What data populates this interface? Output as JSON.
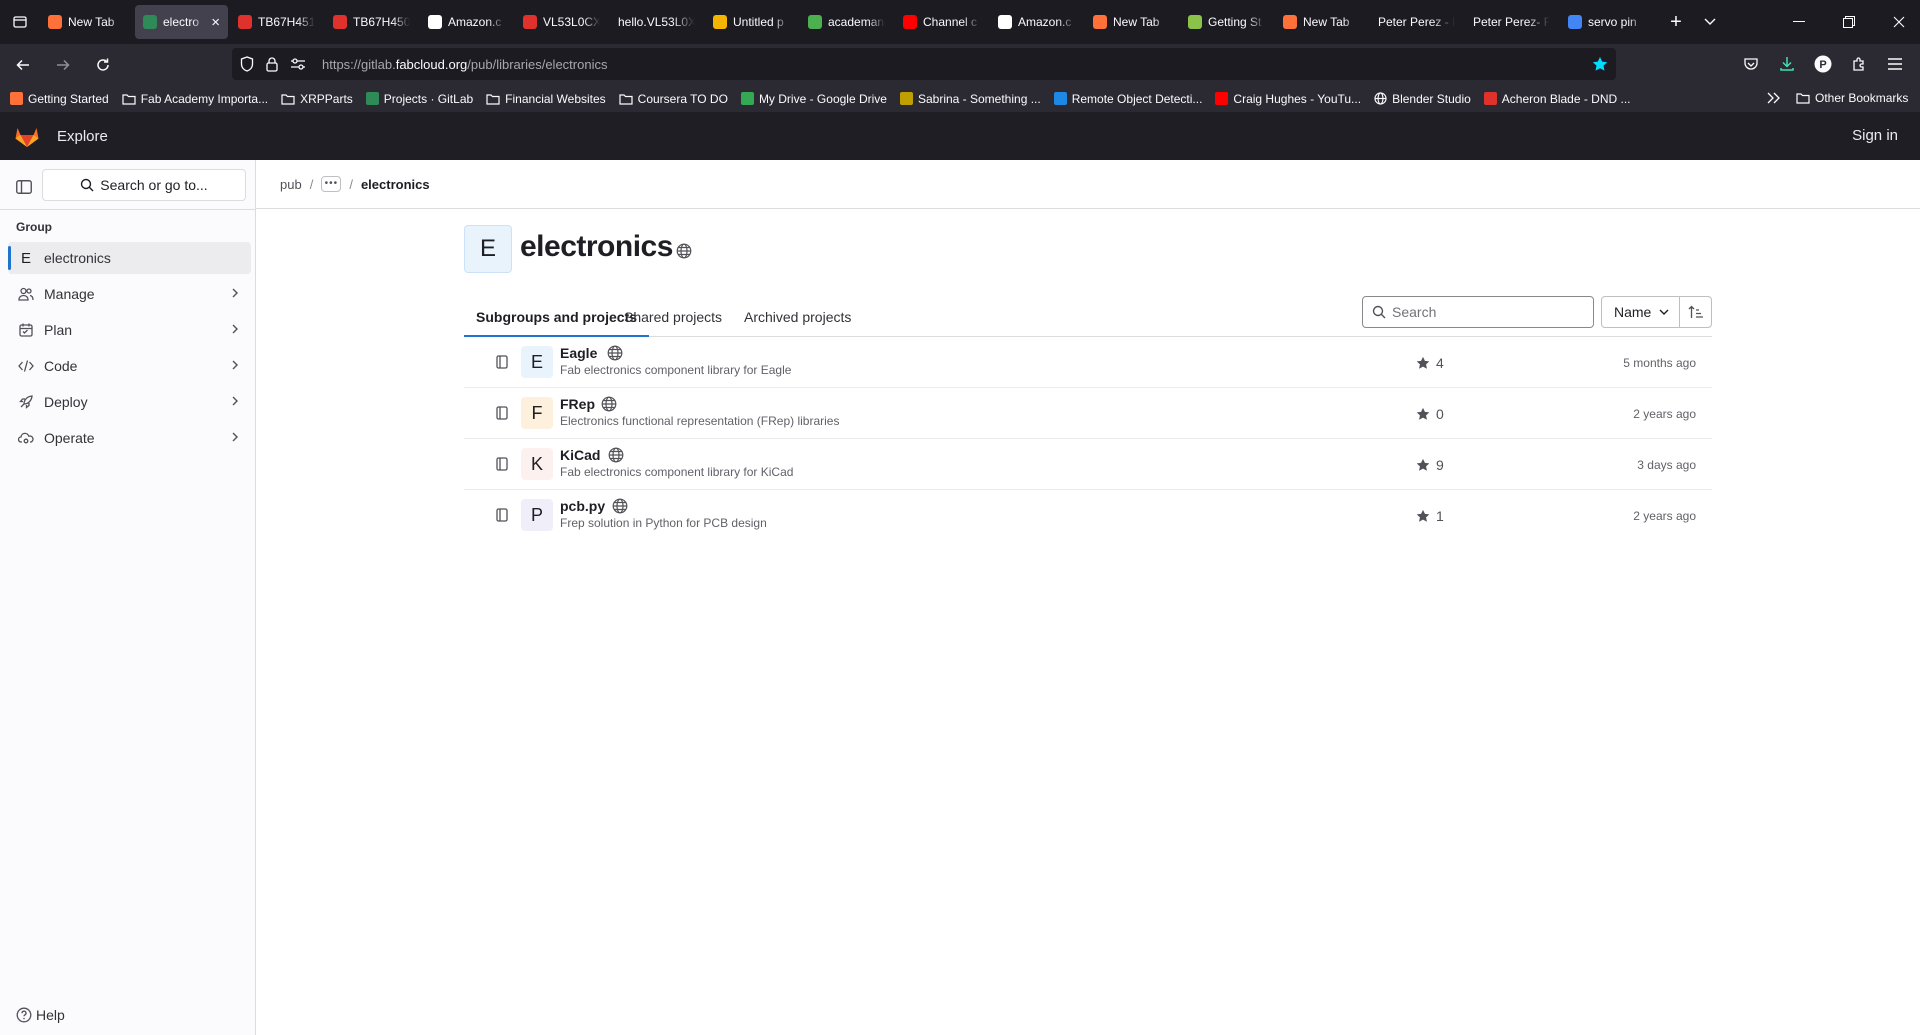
{
  "browser": {
    "tabs": [
      {
        "title": "New Tab",
        "favicon_color": "#ff7139",
        "active": false
      },
      {
        "title": "electro",
        "favicon_color": "#2e8b57",
        "active": true
      },
      {
        "title": "TB67H451",
        "favicon_color": "#e0322d",
        "active": false
      },
      {
        "title": "TB67H450",
        "favicon_color": "#e0322d",
        "active": false
      },
      {
        "title": "Amazon.c",
        "favicon_color": "#ffffff",
        "active": false
      },
      {
        "title": "VL53L0CX",
        "favicon_color": "#e0322d",
        "active": false
      },
      {
        "title": "hello.VL53L0X",
        "favicon_color": "",
        "active": false
      },
      {
        "title": "Untitled p",
        "favicon_color": "#f4b400",
        "active": false
      },
      {
        "title": "academan",
        "favicon_color": "#4caf50",
        "active": false
      },
      {
        "title": "Channel c",
        "favicon_color": "#ff0000",
        "active": false
      },
      {
        "title": "Amazon.c",
        "favicon_color": "#ffffff",
        "active": false
      },
      {
        "title": "New Tab",
        "favicon_color": "#ff7139",
        "active": false
      },
      {
        "title": "Getting St",
        "favicon_color": "#8bc34a",
        "active": false
      },
      {
        "title": "New Tab",
        "favicon_color": "#ff7139",
        "active": false
      },
      {
        "title": "Peter Perez - F",
        "favicon_color": "",
        "active": false
      },
      {
        "title": "Peter Perez- F",
        "favicon_color": "",
        "active": false
      },
      {
        "title": "servo pin",
        "favicon_color": "#4285f4",
        "active": false
      }
    ],
    "tab_close": "×",
    "new_tab": "+",
    "url_prefix": "https://gitlab.",
    "url_domain": "fabcloud.org",
    "url_path": "/pub/libraries/electronics",
    "bookmarks": [
      {
        "label": "Getting Started",
        "icon": "firefox-icon",
        "color": "#ff7139"
      },
      {
        "label": "Fab Academy Importa...",
        "icon": "folder-icon",
        "color": ""
      },
      {
        "label": "XRPParts",
        "icon": "folder-icon",
        "color": ""
      },
      {
        "label": "Projects · GitLab",
        "icon": "gitlab-icon",
        "color": "#2e8b57"
      },
      {
        "label": "Financial Websites",
        "icon": "folder-icon",
        "color": ""
      },
      {
        "label": "Coursera TO DO",
        "icon": "folder-icon",
        "color": ""
      },
      {
        "label": "My Drive - Google Drive",
        "icon": "drive-icon",
        "color": "#34a853"
      },
      {
        "label": "Sabrina - Something ...",
        "icon": "music-icon",
        "color": "#c0a000"
      },
      {
        "label": "Remote Object Detecti...",
        "icon": "hackster-icon",
        "color": "#1e88e5"
      },
      {
        "label": "Craig Hughes - YouTu...",
        "icon": "youtube-icon",
        "color": "#ff0000"
      },
      {
        "label": "Blender Studio",
        "icon": "globe-icon",
        "color": ""
      },
      {
        "label": "Acheron Blade - DND ...",
        "icon": "dnd-icon",
        "color": "#e0322d"
      }
    ],
    "other_bookmarks": "Other Bookmarks"
  },
  "gitlab": {
    "explore": "Explore",
    "sign_in": "Sign in",
    "search_placeholder": "Search or go to...",
    "sidebar": {
      "group_heading": "Group",
      "items": [
        {
          "label": "electronics",
          "icon_letter": "E"
        },
        {
          "label": "Manage"
        },
        {
          "label": "Plan"
        },
        {
          "label": "Code"
        },
        {
          "label": "Deploy"
        },
        {
          "label": "Operate"
        }
      ],
      "help": "Help"
    },
    "breadcrumb": {
      "root": "pub",
      "more": "•••",
      "current": "electronics",
      "separator": "/"
    },
    "group": {
      "avatar_letter": "E",
      "title": "electronics"
    },
    "tabs": [
      "Subgroups and projects",
      "Shared projects",
      "Archived projects"
    ],
    "filter_placeholder": "Search",
    "sort_label": "Name",
    "projects": [
      {
        "letter": "E",
        "name": "Eagle",
        "description": "Fab electronics component library for Eagle",
        "stars": "4",
        "updated": "5 months ago",
        "avatar_bg": "#e9f3fc"
      },
      {
        "letter": "F",
        "name": "FRep",
        "description": "Electronics functional representation (FRep) libraries",
        "stars": "0",
        "updated": "2 years ago",
        "avatar_bg": "#fdf1dd"
      },
      {
        "letter": "K",
        "name": "KiCad",
        "description": "Fab electronics component library for KiCad",
        "stars": "9",
        "updated": "3 days ago",
        "avatar_bg": "#fcf1ef"
      },
      {
        "letter": "P",
        "name": "pcb.py",
        "description": "Frep solution in Python for PCB design",
        "stars": "1",
        "updated": "2 years ago",
        "avatar_bg": "#f0eef9"
      }
    ]
  }
}
